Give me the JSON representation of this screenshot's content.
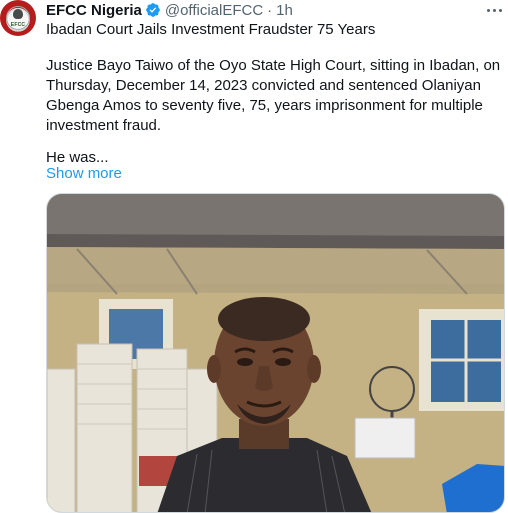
{
  "tweet": {
    "author_name": "EFCC Nigeria",
    "handle": "@officialEFCC",
    "separator": "·",
    "time": "1h",
    "avatar_text": "EFCC",
    "headline": "Ibadan Court Jails Investment Fraudster 75 Years",
    "body": "Justice Bayo Taiwo of the Oyo State High Court, sitting in Ibadan, on Thursday, December 14, 2023 convicted and sentenced Olaniyan Gbenga Amos to seventy five, 75, years imprisonment for multiple investment fraud.",
    "truncated": "He was...",
    "show_more": "Show more"
  },
  "icons": {
    "verified": "verified-badge-icon",
    "more": "more-options-icon"
  },
  "colors": {
    "link": "#1d9bf0",
    "secondary_text": "#536471",
    "primary_text": "#0f1419",
    "avatar_red": "#b71c1c"
  }
}
